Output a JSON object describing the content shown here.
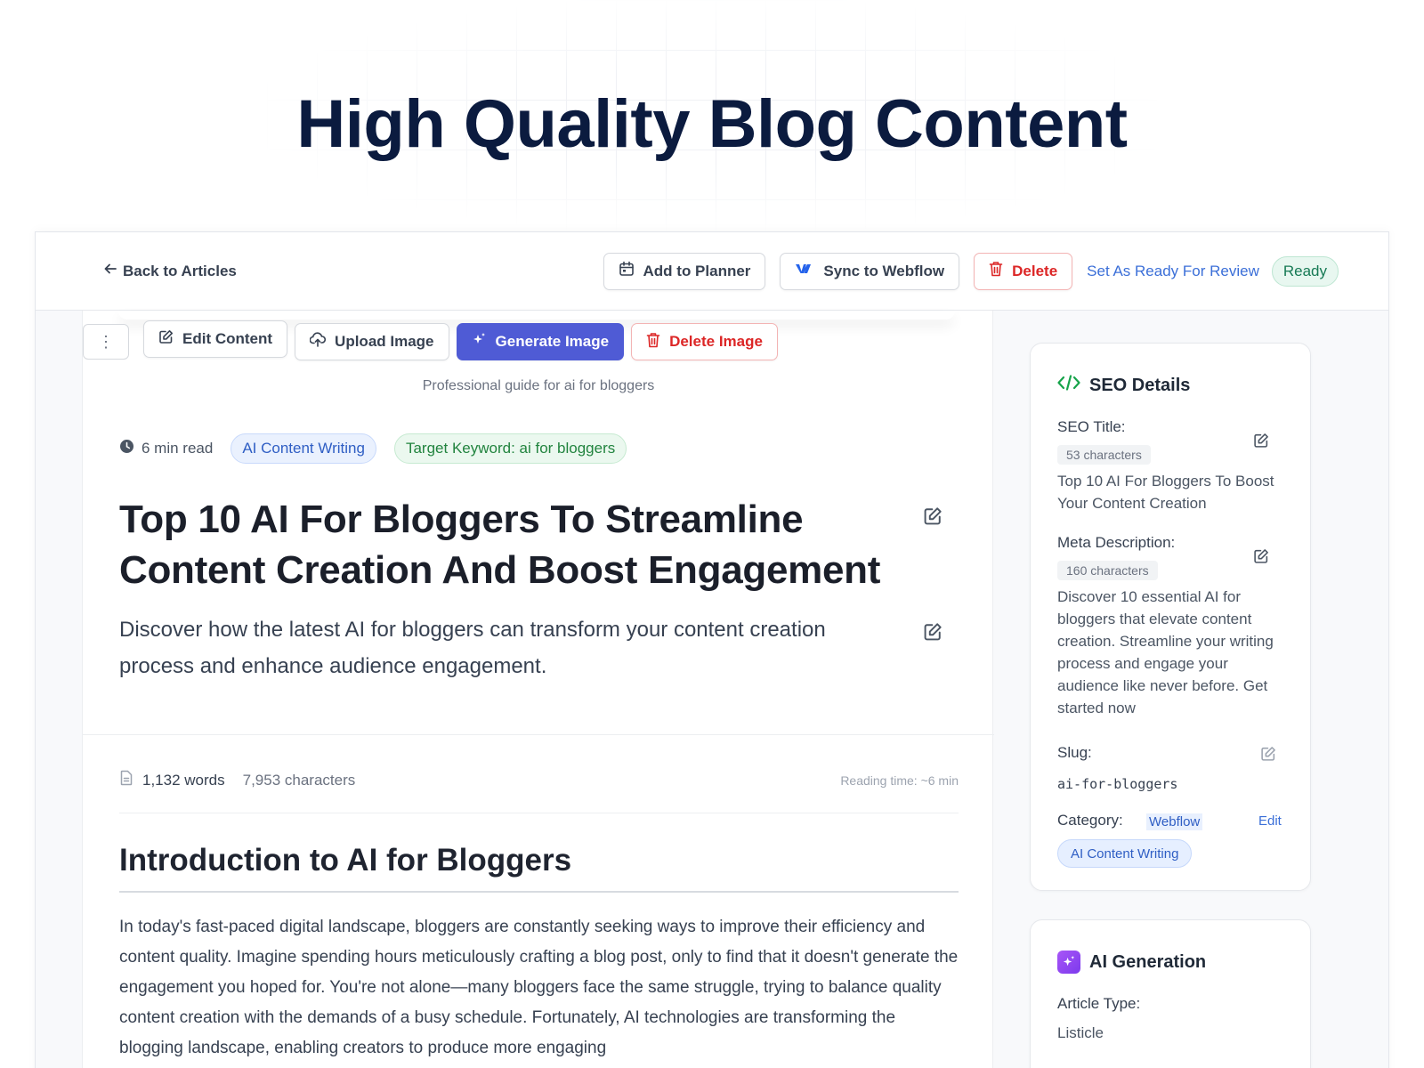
{
  "hero": {
    "title": "High Quality Blog Content"
  },
  "topbar": {
    "back_label": "Back to Articles",
    "add_to_planner": "Add to Planner",
    "sync_webflow": "Sync to Webflow",
    "delete": "Delete",
    "set_ready": "Set As Ready For Review",
    "status": "Ready"
  },
  "image_toolbar": {
    "edit_content": "Edit Content",
    "upload_image": "Upload Image",
    "generate_image": "Generate Image",
    "delete_image": "Delete Image",
    "caption": "Professional guide for ai for bloggers"
  },
  "article": {
    "read_time": "6 min read",
    "category_tag": "AI Content Writing",
    "keyword_tag": "Target Keyword: ai for bloggers",
    "title": "Top 10 AI For Bloggers To Streamline Content Creation And Boost Engagement",
    "description": "Discover how the latest AI for bloggers can transform your content creation process and enhance audience engagement.",
    "word_count": "1,132 words",
    "char_count": "7,953 characters",
    "reading_time": "Reading time: ~6 min",
    "section_heading": "Introduction to AI for Bloggers",
    "body": "In today's fast-paced digital landscape, bloggers are constantly seeking ways to improve their efficiency and content quality. Imagine spending hours meticulously crafting a blog post, only to find that it doesn't generate the engagement you hoped for. You're not alone—many bloggers face the same struggle, trying to balance quality content creation with the demands of a busy schedule. Fortunately, AI technologies are transforming the blogging landscape, enabling creators to produce more engaging"
  },
  "seo": {
    "heading": "SEO Details",
    "seo_title_label": "SEO Title:",
    "seo_title_count": "53 characters",
    "seo_title_value": "Top 10 AI For Bloggers To Boost Your Content Creation",
    "meta_label": "Meta Description:",
    "meta_count": "160 characters",
    "meta_value": "Discover 10 essential AI for bloggers that elevate content creation. Streamline your writing process and engage your audience like never before. Get started now",
    "slug_label": "Slug:",
    "slug_value": "ai-for-bloggers",
    "category_label": "Category:",
    "category_source": "Webflow",
    "category_edit": "Edit",
    "category_value": "AI Content Writing"
  },
  "ai_generation": {
    "heading": "AI Generation",
    "article_type_label": "Article Type:",
    "article_type_value": "Listicle"
  },
  "colors": {
    "primary": "#4f5bd5",
    "danger": "#dc2626",
    "link": "#3b6fd8",
    "ready": "#177a55",
    "hero": "#0b1b3f"
  }
}
